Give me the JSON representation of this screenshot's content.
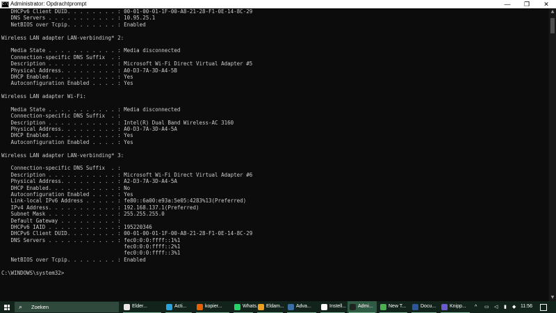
{
  "window": {
    "title": "Administrator: Opdrachtprompt",
    "icon_label": "C:\\",
    "min_glyph": "—",
    "max_glyph": "❐",
    "close_glyph": "✕"
  },
  "console_lines": [
    "   DHCPv6 Client DUID. . . . . . . . : 00-01-00-01-1F-00-A8-21-28-F1-0E-14-8C-29",
    "   DNS Servers . . . . . . . . . . . : 10.95.25.1",
    "   NetBIOS over Tcpip. . . . . . . . : Enabled",
    "",
    "Wireless LAN adapter LAN-verbinding* 2:",
    "",
    "   Media State . . . . . . . . . . . : Media disconnected",
    "   Connection-specific DNS Suffix  . :",
    "   Description . . . . . . . . . . . : Microsoft Wi-Fi Direct Virtual Adapter #5",
    "   Physical Address. . . . . . . . . : A0-D3-7A-3D-A4-5B",
    "   DHCP Enabled. . . . . . . . . . . : Yes",
    "   Autoconfiguration Enabled . . . . : Yes",
    "",
    "Wireless LAN adapter Wi-Fi:",
    "",
    "   Media State . . . . . . . . . . . : Media disconnected",
    "   Connection-specific DNS Suffix  . :",
    "   Description . . . . . . . . . . . : Intel(R) Dual Band Wireless-AC 3160",
    "   Physical Address. . . . . . . . . : A0-D3-7A-3D-A4-5A",
    "   DHCP Enabled. . . . . . . . . . . : Yes",
    "   Autoconfiguration Enabled . . . . : Yes",
    "",
    "Wireless LAN adapter LAN-verbinding* 3:",
    "",
    "   Connection-specific DNS Suffix  . :",
    "   Description . . . . . . . . . . . : Microsoft Wi-Fi Direct Virtual Adapter #6",
    "   Physical Address. . . . . . . . . : A2-D3-7A-3D-A4-5A",
    "   DHCP Enabled. . . . . . . . . . . : No",
    "   Autoconfiguration Enabled . . . . : Yes",
    "   Link-local IPv6 Address . . . . . : fe80::6a00:e93a:5e05:4283%13(Preferred)",
    "   IPv4 Address. . . . . . . . . . . : 192.168.137.1(Preferred)",
    "   Subnet Mask . . . . . . . . . . . : 255.255.255.0",
    "   Default Gateway . . . . . . . . . :",
    "   DHCPv6 IAID . . . . . . . . . . . : 195220346",
    "   DHCPv6 Client DUID. . . . . . . . : 00-01-00-01-1F-00-A8-21-28-F1-0E-14-8C-29",
    "   DNS Servers . . . . . . . . . . . : fec0:0:0:ffff::1%1",
    "                                       fec0:0:0:ffff::2%1",
    "                                       fec0:0:0:ffff::3%1",
    "   NetBIOS over Tcpip. . . . . . . . : Enabled",
    "",
    "C:\\WINDOWS\\system32>"
  ],
  "taskbar": {
    "search_placeholder": "Zoeken",
    "apps": [
      {
        "label": "Elder...",
        "color": "#e8e8e8",
        "icon": "document-icon",
        "active": false
      },
      {
        "label": "Acti...",
        "color": "#2aa3dd",
        "icon": "telegram-icon",
        "active": false
      },
      {
        "label": "kopier...",
        "color": "#e66000",
        "icon": "firefox-icon",
        "active": false
      },
      {
        "label": "Whats...",
        "color": "#25d366",
        "icon": "whatsapp-icon",
        "active": false
      },
      {
        "label": "Eldam...",
        "color": "#f0a020",
        "icon": "vlc-icon",
        "active": false
      },
      {
        "label": "Adva...",
        "color": "#3a6ea5",
        "icon": "window-icon",
        "active": false
      },
      {
        "label": "Instell...",
        "color": "#ffffff",
        "icon": "gear-icon",
        "active": false
      },
      {
        "label": "Admi...",
        "color": "#222222",
        "icon": "cmd-icon",
        "active": true
      },
      {
        "label": "New T...",
        "color": "#4caf50",
        "icon": "chrome-icon",
        "active": false
      },
      {
        "label": "Docu...",
        "color": "#2b579a",
        "icon": "word-icon",
        "active": false
      },
      {
        "label": "Knipp...",
        "color": "#6a5acd",
        "icon": "snipping-icon",
        "active": false
      }
    ],
    "tray": {
      "chevron": "^",
      "time": "11:56"
    }
  }
}
